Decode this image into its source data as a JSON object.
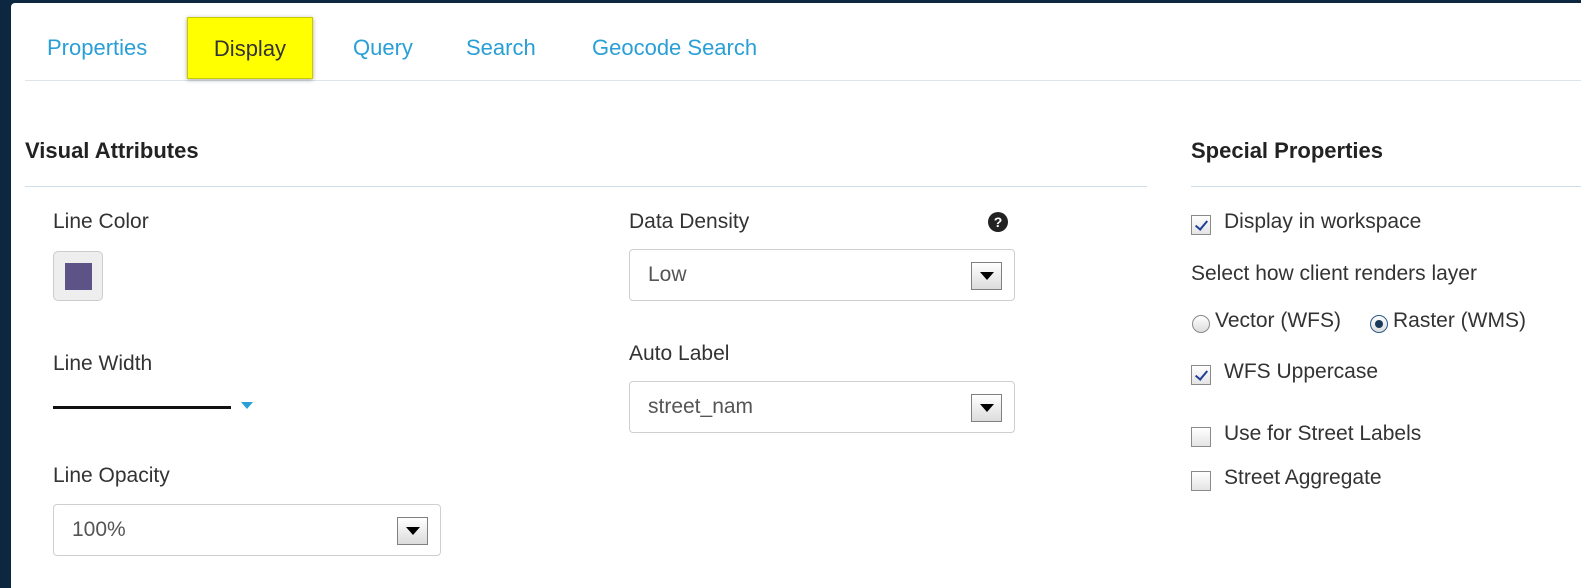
{
  "tabs": [
    {
      "label": "Properties",
      "active": false
    },
    {
      "label": "Display",
      "active": true
    },
    {
      "label": "Query",
      "active": false
    },
    {
      "label": "Search",
      "active": false
    },
    {
      "label": "Geocode Search",
      "active": false
    }
  ],
  "visual": {
    "title": "Visual Attributes",
    "line_color_label": "Line Color",
    "line_color_value": "#5e5387",
    "line_width_label": "Line Width",
    "line_opacity_label": "Line Opacity",
    "line_opacity_value": "100%",
    "data_density_label": "Data Density",
    "data_density_value": "Low",
    "auto_label_label": "Auto Label",
    "auto_label_value": "street_nam",
    "help_icon": "question-circle-icon"
  },
  "special": {
    "title": "Special Properties",
    "display_in_workspace": {
      "label": "Display in workspace",
      "checked": true
    },
    "render_prompt": "Select how client renders layer",
    "render_options": [
      {
        "label": "Vector (WFS)",
        "checked": false
      },
      {
        "label": "Raster (WMS)",
        "checked": true
      }
    ],
    "wfs_uppercase": {
      "label": "WFS Uppercase",
      "checked": true
    },
    "street_labels": {
      "label": "Use for Street Labels",
      "checked": false
    },
    "street_aggregate": {
      "label": "Street Aggregate",
      "checked": false
    }
  },
  "colors": {
    "accent": "#2a9fd6",
    "active_tab": "#ffff00",
    "frame": "#0e2740"
  }
}
